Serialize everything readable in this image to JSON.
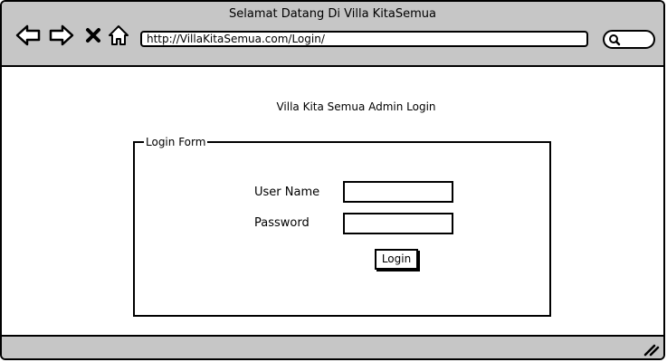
{
  "browser": {
    "window_title": "Selamat Datang Di Villa KitaSemua",
    "url": "http://VillaKitaSemua.com/Login/",
    "icons": [
      "back-arrow-icon",
      "forward-arrow-icon",
      "close-x-icon",
      "home-icon",
      "search-icon",
      "resize-grip-icon"
    ]
  },
  "page": {
    "heading": "Villa Kita Semua Admin Login",
    "form": {
      "legend": "Login Form",
      "username_label": "User Name",
      "username_value": "",
      "password_label": "Password",
      "password_value": "",
      "submit_label": "Login"
    }
  },
  "colors": {
    "chrome": "#c6c6c6",
    "border": "#000000",
    "background": "#ffffff"
  }
}
